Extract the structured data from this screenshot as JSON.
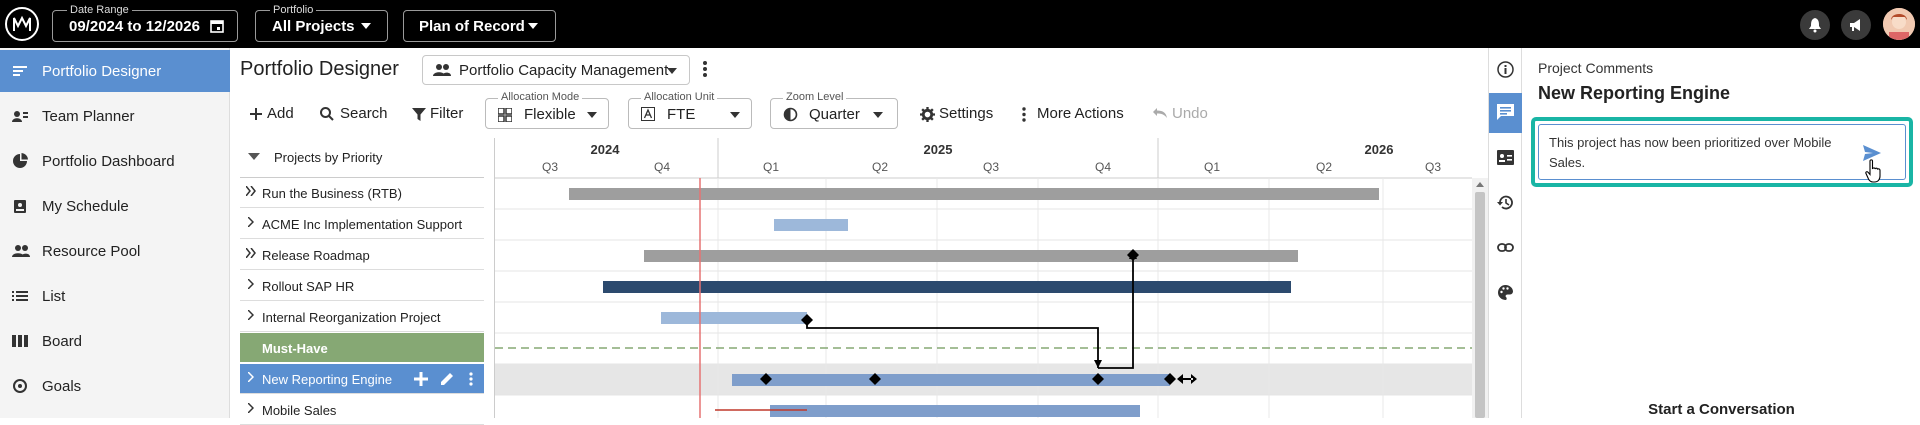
{
  "topbar": {
    "date_range_label": "Date Range",
    "date_range_value": "09/2024 to 12/2026",
    "portfolio_label": "Portfolio",
    "portfolio_value": "All Projects",
    "plan_value": "Plan of Record"
  },
  "sidebar": {
    "items": [
      {
        "label": "Portfolio Designer",
        "icon": "portfolio-designer-icon"
      },
      {
        "label": "Team Planner",
        "icon": "team-planner-icon"
      },
      {
        "label": "Portfolio Dashboard",
        "icon": "dashboard-icon"
      },
      {
        "label": "My Schedule",
        "icon": "schedule-icon"
      },
      {
        "label": "Resource Pool",
        "icon": "people-icon"
      },
      {
        "label": "List",
        "icon": "list-icon"
      },
      {
        "label": "Board",
        "icon": "board-icon"
      },
      {
        "label": "Goals",
        "icon": "goals-icon"
      }
    ]
  },
  "main": {
    "title": "Portfolio Designer",
    "view_select": "Portfolio Capacity Management",
    "toolbar": {
      "add": "Add",
      "search": "Search",
      "filter": "Filter",
      "allocation_mode_label": "Allocation Mode",
      "allocation_mode_value": "Flexible",
      "allocation_unit_label": "Allocation Unit",
      "allocation_unit_value": "FTE",
      "zoom_label": "Zoom Level",
      "zoom_value": "Quarter",
      "settings": "Settings",
      "more_actions": "More Actions",
      "undo": "Undo"
    },
    "grid_header": "Projects by Priority",
    "timeline": {
      "years": [
        "2024",
        "2025",
        "2026"
      ],
      "quarters": [
        "Q3",
        "Q4",
        "Q1",
        "Q2",
        "Q3",
        "Q4",
        "Q1",
        "Q2",
        "Q3"
      ]
    },
    "rows": [
      {
        "name": "Run the Business (RTB)",
        "chevron": "double"
      },
      {
        "name": "ACME Inc Implementation Support",
        "chevron": "single"
      },
      {
        "name": "Release Roadmap",
        "chevron": "double"
      },
      {
        "name": "Rollout SAP HR",
        "chevron": "single"
      },
      {
        "name": "Internal Reorganization Project",
        "chevron": "single"
      },
      {
        "name": "Must-Have",
        "chevron": "none"
      },
      {
        "name": "New Reporting Engine",
        "chevron": "single"
      },
      {
        "name": "Mobile Sales",
        "chevron": "single"
      }
    ]
  },
  "panel": {
    "section": "Project Comments",
    "title": "New Reporting Engine",
    "comment_text": "This project has now been prioritized over Mobile Sales.",
    "empty_state": "Start a Conversation"
  },
  "colors": {
    "accent": "#5a8fd0",
    "must_have": "#86a874",
    "comment_border": "#19b5a5",
    "bar_gray": "#9e9e9e",
    "bar_light_blue": "#9db8da",
    "bar_navy": "#2c4a6e",
    "today_line": "#e57373"
  }
}
